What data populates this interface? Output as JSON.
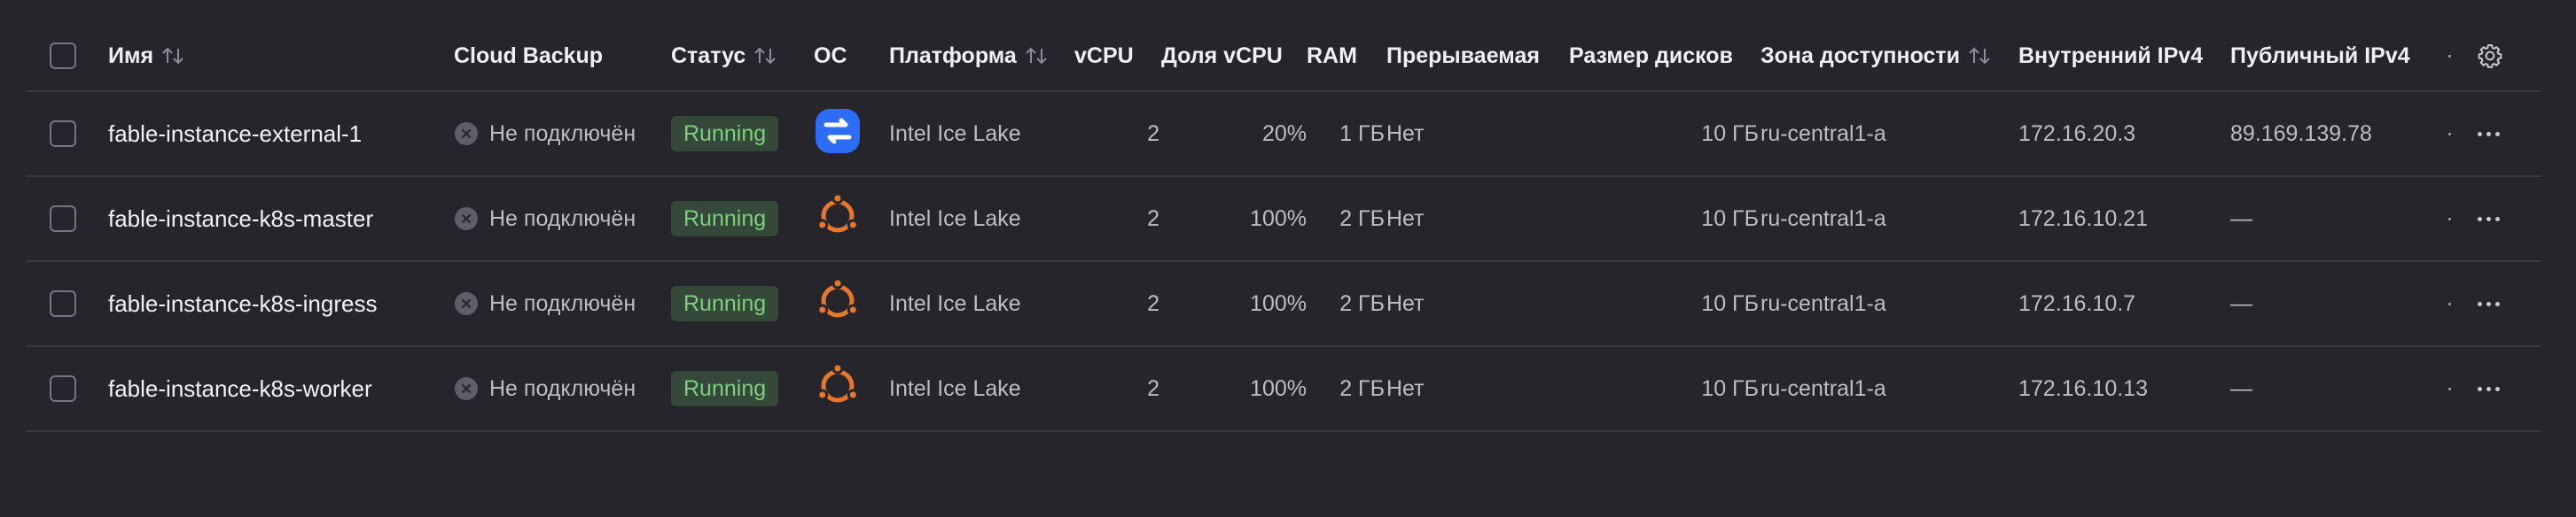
{
  "columns": {
    "name": "Имя",
    "backup": "Cloud Backup",
    "status": "Статус",
    "os": "ОС",
    "platform": "Платформа",
    "vcpu": "vCPU",
    "vcpu_share": "Доля vCPU",
    "ram": "RAM",
    "preemptible": "Прерываемая",
    "disk_size": "Размер дисков",
    "zone": "Зона доступности",
    "internal_ipv4": "Внутренний IPv4",
    "public_ipv4": "Публичный IPv4"
  },
  "rows": [
    {
      "name": "fable-instance-external-1",
      "backup": "Не подключён",
      "status": "Running",
      "os_icon": "blue-os-icon",
      "platform": "Intel Ice Lake",
      "vcpu": "2",
      "vcpu_share": "20%",
      "ram": "1 ГБ",
      "preemptible": "Нет",
      "disk_size": "10 ГБ",
      "zone": "ru-central1-a",
      "internal_ipv4": "172.16.20.3",
      "public_ipv4": "89.169.139.78"
    },
    {
      "name": "fable-instance-k8s-master",
      "backup": "Не подключён",
      "status": "Running",
      "os_icon": "ubuntu-icon",
      "platform": "Intel Ice Lake",
      "vcpu": "2",
      "vcpu_share": "100%",
      "ram": "2 ГБ",
      "preemptible": "Нет",
      "disk_size": "10 ГБ",
      "zone": "ru-central1-a",
      "internal_ipv4": "172.16.10.21",
      "public_ipv4": "—"
    },
    {
      "name": "fable-instance-k8s-ingress",
      "backup": "Не подключён",
      "status": "Running",
      "os_icon": "ubuntu-icon",
      "platform": "Intel Ice Lake",
      "vcpu": "2",
      "vcpu_share": "100%",
      "ram": "2 ГБ",
      "preemptible": "Нет",
      "disk_size": "10 ГБ",
      "zone": "ru-central1-a",
      "internal_ipv4": "172.16.10.7",
      "public_ipv4": "—"
    },
    {
      "name": "fable-instance-k8s-worker",
      "backup": "Не подключён",
      "status": "Running",
      "os_icon": "ubuntu-icon",
      "platform": "Intel Ice Lake",
      "vcpu": "2",
      "vcpu_share": "100%",
      "ram": "2 ГБ",
      "preemptible": "Нет",
      "disk_size": "10 ГБ",
      "zone": "ru-central1-a",
      "internal_ipv4": "172.16.10.13",
      "public_ipv4": "—"
    }
  ],
  "colors": {
    "background": "#26252b",
    "status_running_bg": "#34493a",
    "status_running_text": "#7fd07c",
    "os_blue": "#2d6df6",
    "ubuntu_orange": "#e8772e"
  }
}
